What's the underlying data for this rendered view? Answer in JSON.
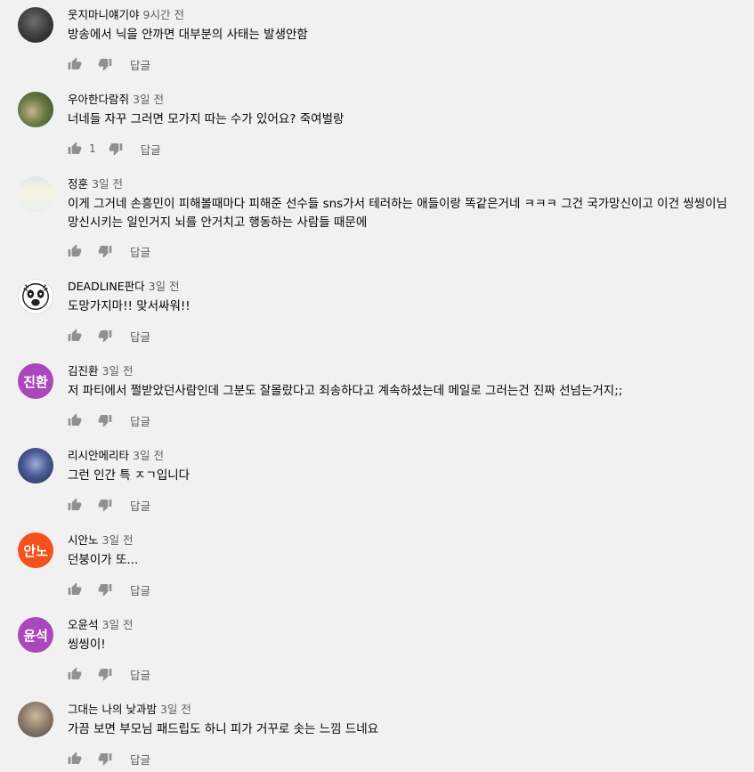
{
  "reply_label": "답글",
  "comments": [
    {
      "author": "웃지마니얘기야",
      "time": "9시간 전",
      "text": "방송에서 닉을 안까면 대부분의 사태는 발생안함",
      "likes": "",
      "avatar_letters": ""
    },
    {
      "author": "우아한다람쥐",
      "time": "3일 전",
      "text": "너네들 자꾸 그러면 모가지 따는 수가 있어요? 죽여벌랑",
      "likes": "1",
      "avatar_letters": ""
    },
    {
      "author": "정훈",
      "time": "3일 전",
      "text": "이게 그거네 손흥민이 피해볼때마다 피해준 선수들 sns가서 테러하는 애들이랑 똑같은거네 ㅋㅋㅋ 그건 국가망신이고 이건 씽씽이님 망신시키는 일인거지 뇌를 안거치고 행동하는 사람들 때문에",
      "likes": "",
      "avatar_letters": ""
    },
    {
      "author": "DEADLINE판다",
      "time": "3일 전",
      "text": "도망가지마!! 맞서싸워!!",
      "likes": "",
      "avatar_letters": ""
    },
    {
      "author": "김진환",
      "time": "3일 전",
      "text": "저 파티에서 쩔받았던사람인데 그분도 잘몰랐다고 죄송하다고 계속하셨는데 메일로 그러는건 진짜 선넘는거지;;",
      "likes": "",
      "avatar_letters": "진환",
      "avatar_color": "#ab47bc"
    },
    {
      "author": "리시안메리타",
      "time": "3일 전",
      "text": "그런 인간 특 ㅈㄱ입니다",
      "likes": "",
      "avatar_letters": ""
    },
    {
      "author": "시안노",
      "time": "3일 전",
      "text": "던붕이가 또...",
      "likes": "",
      "avatar_letters": "안노",
      "avatar_color": "#f4511e"
    },
    {
      "author": "오윤석",
      "time": "3일 전",
      "text": "씽씽이!",
      "likes": "",
      "avatar_letters": "윤석",
      "avatar_color": "#ab47bc"
    },
    {
      "author": "그대는 나의 낮과밤",
      "time": "3일 전",
      "text": "가끔 보면 부모님 패드립도 하니 피가 거꾸로 솟는 느낌 드네요",
      "likes": "",
      "avatar_letters": ""
    }
  ],
  "icons": {
    "like": "thumbs-up-icon",
    "dislike": "thumbs-down-icon"
  },
  "colors": {
    "background": "#f1f1f1",
    "author_text": "#030303",
    "secondary_text": "#606060",
    "icon": "#909090"
  }
}
